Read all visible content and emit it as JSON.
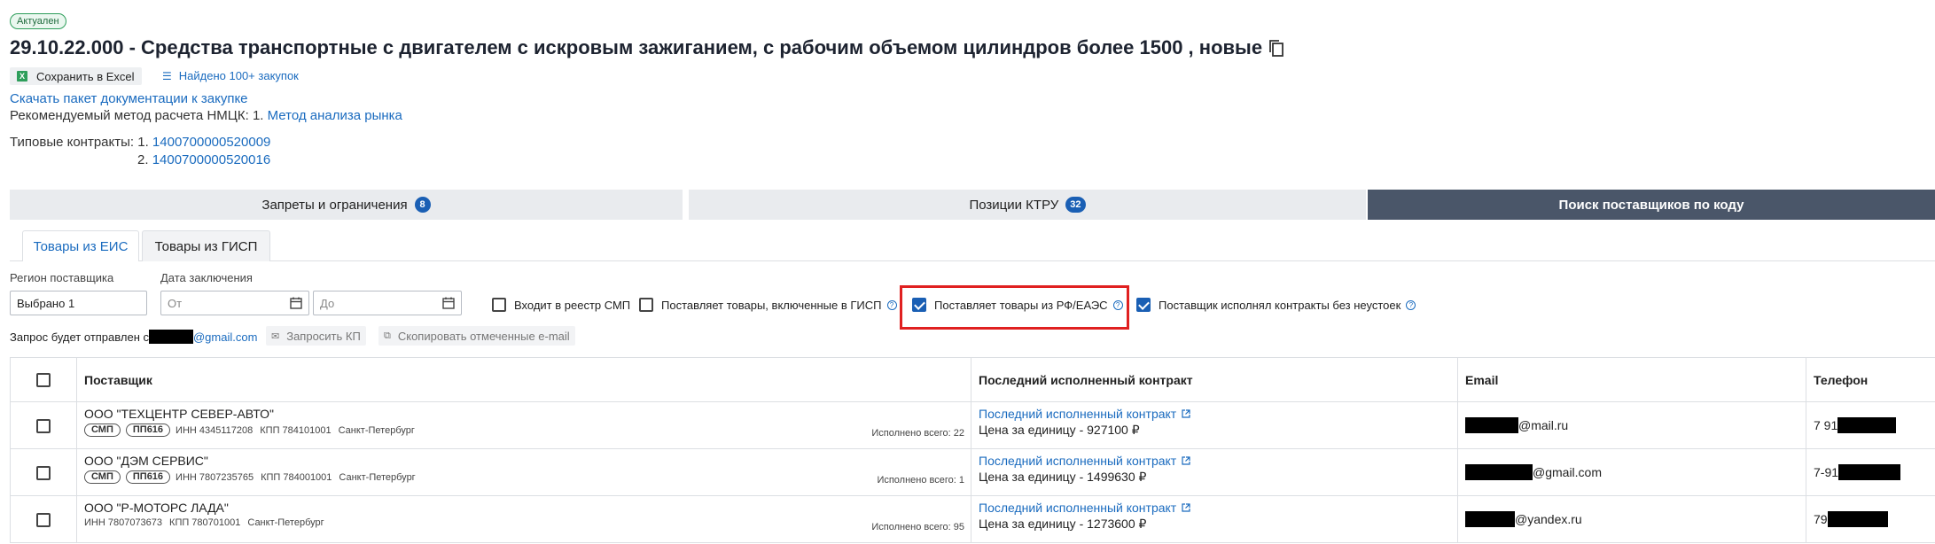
{
  "status_badge": "Актуален",
  "title": "29.10.22.000 - Средства транспортные с двигателем с искровым зажиганием, с рабочим объемом цилиндров более 1500  , новые",
  "toolbar": {
    "excel_label": "Сохранить в Excel",
    "found_label": "Найдено 100+ закупок"
  },
  "links": {
    "download_docs": "Скачать пакет документации к закупке"
  },
  "method": {
    "prefix": "Рекомендуемый метод расчета НМЦК: 1.",
    "value": "Метод анализа рынка"
  },
  "typical_contracts": {
    "label": "Типовые контракты: 1.",
    "item1": "1400700000520009",
    "item2_prefix": "2.",
    "item2": "1400700000520016"
  },
  "main_tabs": [
    {
      "label": "Запреты и ограничения",
      "count": "8"
    },
    {
      "label": "Позиции КТРУ",
      "count": "32"
    },
    {
      "label": "Поиск поставщиков по коду"
    }
  ],
  "sub_tabs": [
    {
      "label": "Товары из ЕИС",
      "active": true
    },
    {
      "label": "Товары из ГИСП",
      "active": false
    }
  ],
  "filters": {
    "region_label": "Регион поставщика",
    "region_value": "Выбрано 1",
    "date_label": "Дата заключения",
    "date_from_placeholder": "От",
    "date_to_placeholder": "До",
    "checkboxes": [
      {
        "label": "Входит в реестр СМП",
        "checked": false
      },
      {
        "label": "Поставляет товары, включенные в ГИСП",
        "checked": false
      },
      {
        "label": "Поставляет товары из РФ/ЕАЭС",
        "checked": true
      },
      {
        "label": "Поставщик исполнял контракты без неустоек",
        "checked": true
      }
    ]
  },
  "request": {
    "prefix": "Запрос будет отправлен с",
    "email_suffix": "@gmail.com",
    "request_kp": "Запросить КП",
    "copy_emails": "Скопировать отмеченные e-mail"
  },
  "table": {
    "headers": {
      "supplier": "Поставщик",
      "contract": "Последний исполненный контракт",
      "email": "Email",
      "phone": "Телефон"
    },
    "rows": [
      {
        "name": "ООО \"ТЕХЦЕНТР СЕВЕР-АВТО\"",
        "tags": [
          "СМП",
          "ПП616"
        ],
        "inn": "ИНН 4345117208",
        "kpp": "КПП 784101001",
        "city": "Санкт-Петербург",
        "done": "Исполнено всего: 22",
        "contract_link": "Последний исполненный контракт",
        "price": "Цена за единицу - 927100 ₽",
        "email_suffix": "@mail.ru",
        "phone_prefix": "7 91"
      },
      {
        "name": "ООО \"ДЭМ СЕРВИС\"",
        "tags": [
          "СМП",
          "ПП616"
        ],
        "inn": "ИНН 7807235765",
        "kpp": "КПП 784001001",
        "city": "Санкт-Петербург",
        "done": "Исполнено всего: 1",
        "contract_link": "Последний исполненный контракт",
        "price": "Цена за единицу - 1499630 ₽",
        "email_suffix": "@gmail.com",
        "phone_prefix": "7-91"
      },
      {
        "name": "ООО \"Р-МОТОРС ЛАДА\"",
        "tags": [],
        "inn": "ИНН 7807073673",
        "kpp": "КПП 780701001",
        "city": "Санкт-Петербург",
        "done": "Исполнено всего: 95",
        "contract_link": "Последний исполненный контракт",
        "price": "Цена за единицу - 1273600 ₽",
        "email_suffix": "@yandex.ru",
        "phone_prefix": "79"
      }
    ]
  },
  "colors": {
    "link": "#1a6bbf",
    "accent": "#1a5fb4",
    "dark_tab": "#4a5669",
    "highlight": "#e02020",
    "status_green": "#2e9e5b"
  }
}
